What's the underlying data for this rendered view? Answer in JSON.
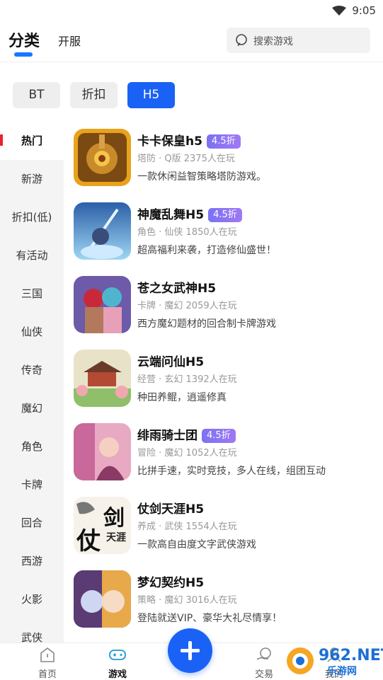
{
  "status_bar": {
    "time": "9:05"
  },
  "header": {
    "tabs": [
      {
        "label": "分类",
        "active": true
      },
      {
        "label": "开服",
        "active": false
      }
    ],
    "search": {
      "placeholder": "搜索游戏"
    }
  },
  "filters": [
    {
      "label": "BT",
      "active": false
    },
    {
      "label": "折扣",
      "active": false
    },
    {
      "label": "H5",
      "active": true
    }
  ],
  "sidebar": {
    "items": [
      {
        "label": "热门",
        "active": true
      },
      {
        "label": "新游",
        "active": false
      },
      {
        "label": "折扣(低)",
        "active": false
      },
      {
        "label": "有活动",
        "active": false
      },
      {
        "label": "三国",
        "active": false
      },
      {
        "label": "仙侠",
        "active": false
      },
      {
        "label": "传奇",
        "active": false
      },
      {
        "label": "魔幻",
        "active": false
      },
      {
        "label": "角色",
        "active": false
      },
      {
        "label": "卡牌",
        "active": false
      },
      {
        "label": "回合",
        "active": false
      },
      {
        "label": "西游",
        "active": false
      },
      {
        "label": "火影",
        "active": false
      },
      {
        "label": "武侠",
        "active": false
      }
    ]
  },
  "games": [
    {
      "name": "卡卡保皇h5",
      "badge": "4.5折",
      "meta": "塔防 · Q版   2375人在玩",
      "desc": "一款休闲益智策略塔防游戏。"
    },
    {
      "name": "神魔乱舞H5",
      "badge": "4.5折",
      "meta": "角色 · 仙侠   1850人在玩",
      "desc": "超高福利来袭，打造修仙盛世！"
    },
    {
      "name": "苍之女武神H5",
      "badge": "",
      "meta": "卡牌 · 魔幻   2059人在玩",
      "desc": "西方魔幻题材的回合制卡牌游戏"
    },
    {
      "name": "云端问仙H5",
      "badge": "",
      "meta": "经营 · 玄幻   1392人在玩",
      "desc": "种田养鲲，逍遥修真"
    },
    {
      "name": "绯雨骑士团",
      "badge": "4.5折",
      "meta": "冒险 · 魔幻   1052人在玩",
      "desc": "比拼手速，实时竞技，多人在线，组团互动"
    },
    {
      "name": "仗剑天涯H5",
      "badge": "",
      "meta": "养成 · 武侠   1554人在玩",
      "desc": "一款高自由度文字武侠游戏"
    },
    {
      "name": "梦幻契约H5",
      "badge": "",
      "meta": "策略 · 魔幻   3016人在玩",
      "desc": "登陆就送VIP、豪华大礼尽情享！"
    }
  ],
  "game_icons": [
    "tower-defense-icon",
    "sword-warrior-icon",
    "valkyrie-heroes-icon",
    "pavilion-garden-icon",
    "pink-knight-icon",
    "sword-calligraphy-icon",
    "fantasy-contract-icon"
  ],
  "icon_art": {
    "icon6_text_1": "剑",
    "icon6_text_2": "仗",
    "icon6_text_3": "天涯"
  },
  "bottom_nav": {
    "items": [
      {
        "label": "首页",
        "icon": "home-icon",
        "active": false
      },
      {
        "label": "游戏",
        "icon": "gamepad-icon",
        "active": true
      },
      {
        "label": "交易",
        "icon": "trade-icon",
        "active": false
      },
      {
        "label": "我的",
        "icon": "profile-icon",
        "active": false
      }
    ],
    "fab": "plus-icon"
  },
  "watermark": {
    "text": "962.NET",
    "sub": "乐游网"
  },
  "colors": {
    "accent": "#1a62f5",
    "badge": "#8a75f4",
    "side_mark": "#e8222f"
  }
}
